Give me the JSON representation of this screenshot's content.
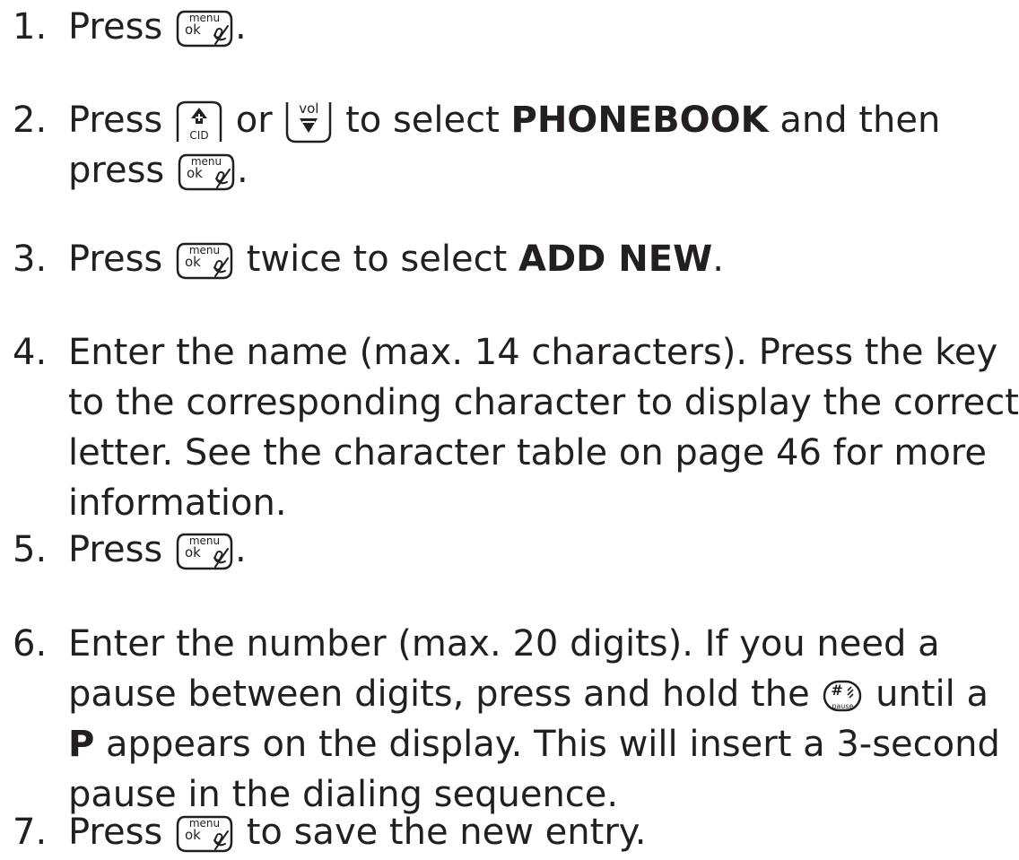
{
  "steps": [
    {
      "number": "1.",
      "lines": [
        [
          {
            "t": "Press "
          },
          {
            "k": "menu_ok"
          },
          {
            "t": "."
          }
        ]
      ]
    },
    {
      "number": "2.",
      "lines": [
        [
          {
            "t": "Press "
          },
          {
            "k": "cid_up"
          },
          {
            "t": " or "
          },
          {
            "k": "vol_down"
          },
          {
            "t": " to select "
          },
          {
            "b": "PHONEBOOK"
          },
          {
            "t": " and then"
          }
        ],
        [
          {
            "t": "press "
          },
          {
            "k": "menu_ok"
          },
          {
            "t": "."
          }
        ]
      ]
    },
    {
      "number": "3.",
      "lines": [
        [
          {
            "t": "Press "
          },
          {
            "k": "menu_ok"
          },
          {
            "t": " twice to select "
          },
          {
            "b": "ADD NEW"
          },
          {
            "t": "."
          }
        ]
      ]
    },
    {
      "number": "4.",
      "lines": [
        [
          {
            "t": "Enter the name (max. 14 characters). Press the key"
          }
        ],
        [
          {
            "t": "to the corresponding character to display the correct"
          }
        ],
        [
          {
            "t": "letter. See the character table on page 46 for more"
          }
        ],
        [
          {
            "t": "information."
          }
        ]
      ]
    },
    {
      "number": "5.",
      "lines": [
        [
          {
            "t": "Press "
          },
          {
            "k": "menu_ok"
          },
          {
            "t": "."
          }
        ]
      ]
    },
    {
      "number": "6.",
      "lines": [
        [
          {
            "t": "Enter the number (max. 20 digits). If you need a"
          }
        ],
        [
          {
            "t": "pause between digits, press and hold the "
          },
          {
            "k": "hash_pause"
          },
          {
            "t": " until a"
          }
        ],
        [
          {
            "b": "P"
          },
          {
            "t": " appears on the display. This will insert a 3-second"
          }
        ],
        [
          {
            "t": "pause in the dialing sequence."
          }
        ]
      ]
    },
    {
      "number": "7.",
      "lines": [
        [
          {
            "t": "Press "
          },
          {
            "k": "menu_ok"
          },
          {
            "t": " to save the new entry."
          }
        ]
      ]
    }
  ],
  "keys": {
    "menu_ok": {
      "icon": "menu-ok-mute-key-icon",
      "top": "menu",
      "main": "ok"
    },
    "cid_up": {
      "icon": "up-cid-key-icon",
      "bottom": "CID"
    },
    "vol_down": {
      "icon": "vol-down-key-icon",
      "top": "vol"
    },
    "hash_pause": {
      "icon": "hash-pause-key-icon",
      "main": "#",
      "bottom": "pause"
    }
  }
}
